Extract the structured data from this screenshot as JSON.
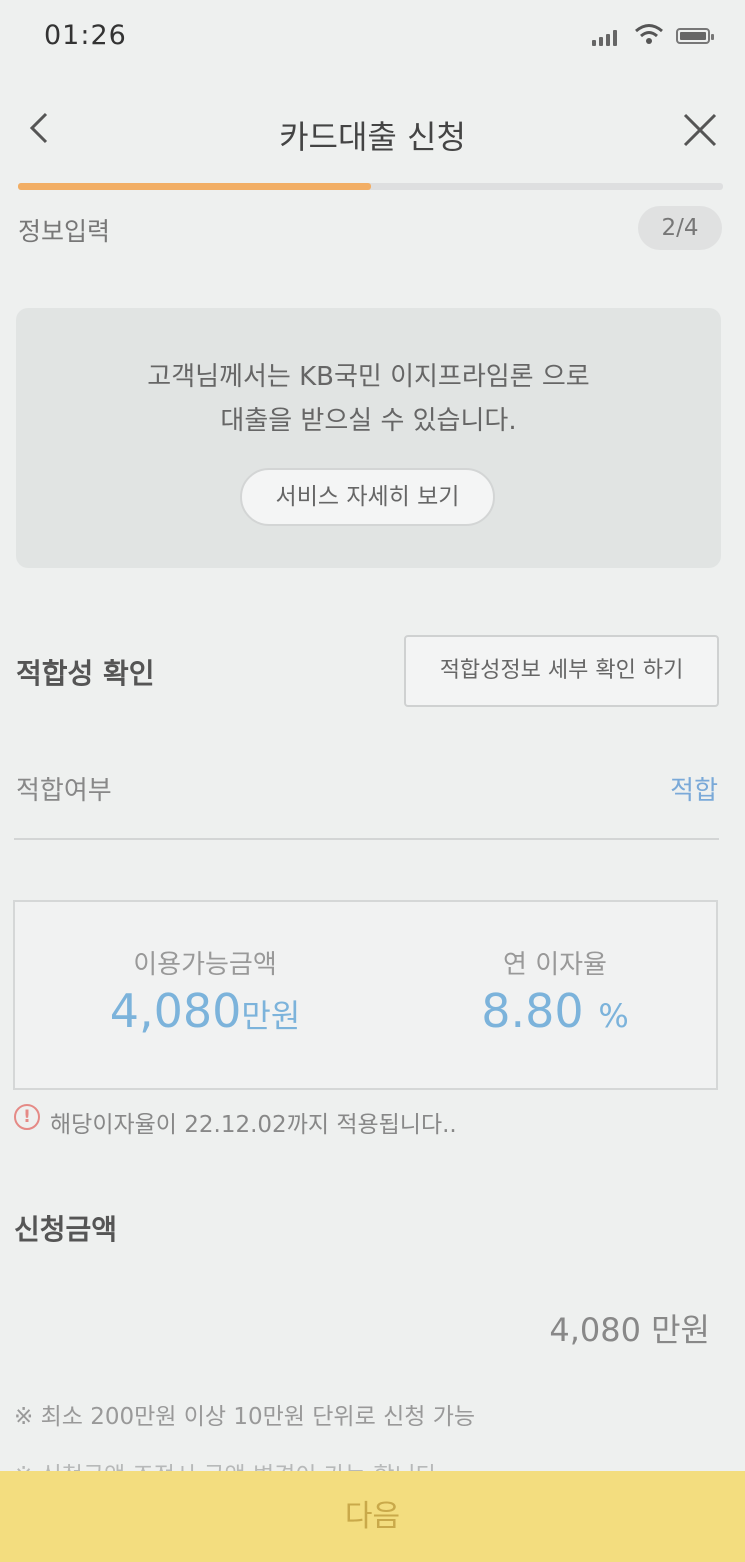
{
  "status_bar": {
    "time": "01:26"
  },
  "header": {
    "back_icon": "chevron-left-icon",
    "title": "카드대출 신청",
    "close_icon": "close-icon"
  },
  "progress": {
    "fraction": 0.5,
    "step_label": "정보입력",
    "step_badge": "2/4"
  },
  "info_box": {
    "line1": "고객님께서는 KB국민 이지프라임론 으로",
    "line2": "대출을 받으실 수 있습니다.",
    "service_button": "서비스 자세히 보기"
  },
  "suitability": {
    "title": "적합성 확인",
    "detail_button": "적합성정보 세부 확인 하기",
    "result_label": "적합여부",
    "result_value": "적합"
  },
  "amount": {
    "available_label": "이용가능금액",
    "available_value": "4,080",
    "available_unit": "만원",
    "rate_label": "연 이자율",
    "rate_value": "8.80",
    "rate_unit": "%"
  },
  "notice": {
    "icon": "exclamation-circle-icon",
    "text": "해당이자율이 22.12.02까지 적용됩니다.."
  },
  "request": {
    "title": "신청금액",
    "value": "4,080 만원",
    "note": "※ 최소 200만원 이상 10만원 단위로 신청 가능",
    "note2": "※ 신청금액 조정시 금액 변경이 가능 합니다"
  },
  "footer": {
    "next_button": "다음"
  },
  "colors": {
    "accent": "#f2ae64",
    "link": "#7aa9d8",
    "button": "#f3dd7f"
  }
}
